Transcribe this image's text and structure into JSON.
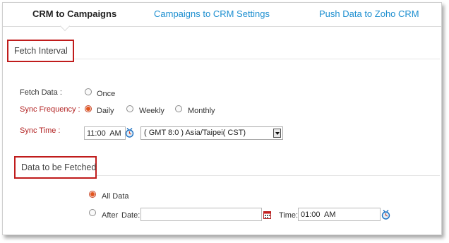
{
  "tabs": [
    {
      "label": "CRM to Campaigns",
      "active": true
    },
    {
      "label": "Campaigns to CRM Settings",
      "active": false
    },
    {
      "label": "Push Data to Zoho CRM",
      "active": false
    }
  ],
  "fetch_interval": {
    "title": "Fetch Interval",
    "fetch_data_label": "Fetch Data :",
    "fetch_data_options": [
      {
        "label": "Once",
        "checked": false
      }
    ],
    "sync_frequency_label": "Sync Frequency :",
    "sync_frequency_options": [
      {
        "label": "Daily",
        "checked": true
      },
      {
        "label": "Weekly",
        "checked": false
      },
      {
        "label": "Monthly",
        "checked": false
      }
    ],
    "sync_time_label": "Sync Time :",
    "sync_time_value": "11:00  AM",
    "timezone_value": "( GMT 8:0 ) Asia/Taipei( CST)"
  },
  "data_to_fetch": {
    "title": "Data to be Fetched",
    "all_data_label": "All Data",
    "all_data_checked": true,
    "after_label": "After",
    "after_checked": false,
    "date_label": "Date:",
    "date_value": "",
    "time_label": "Time:",
    "time_value": "01:00  AM"
  },
  "colors": {
    "accent": "#1d8fd0",
    "required": "#b22222",
    "highlight_border": "#c01c1c",
    "radio_selected": "#e2551f"
  },
  "icons": [
    "clock-icon",
    "calendar-icon",
    "clock-icon"
  ]
}
